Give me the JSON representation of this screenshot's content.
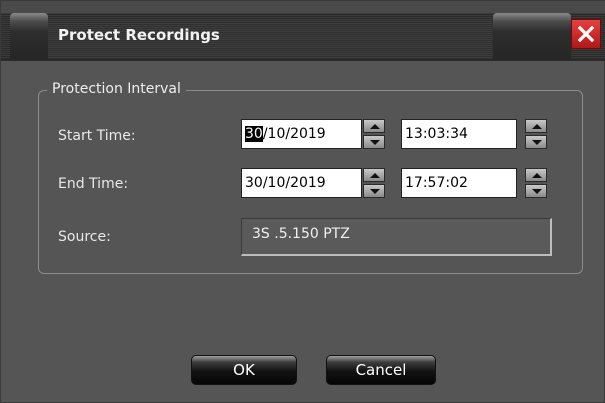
{
  "window": {
    "title": "Protect Recordings"
  },
  "group": {
    "legend": "Protection Interval"
  },
  "fields": {
    "start_label": "Start Time:",
    "start_date_selected": "30",
    "start_date_rest": "/10/2019",
    "start_time": "13:03:34",
    "end_label": "End Time:",
    "end_date": "30/10/2019",
    "end_time": "17:57:02",
    "source_label": "Source:",
    "source_value": "3S .5.150 PTZ"
  },
  "buttons": {
    "ok": "OK",
    "cancel": "Cancel"
  },
  "icons": {
    "close": "close-icon",
    "spin_up": "triangle-up-icon",
    "spin_down": "triangle-down-icon"
  },
  "colors": {
    "close_button": "#d42a2a",
    "dialog_background": "#555555",
    "title_text": "#f2f2f2"
  }
}
